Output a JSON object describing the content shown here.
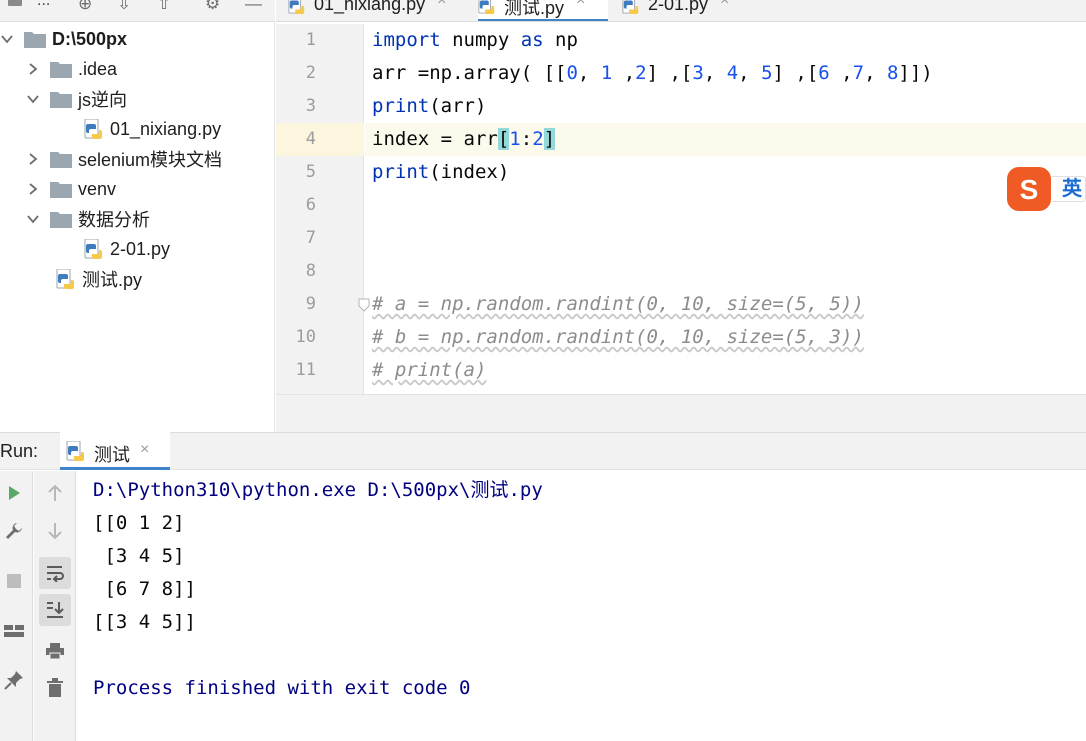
{
  "project_pane": {
    "toolbar_label": "..."
  },
  "tree": [
    {
      "label": "D:\\500px",
      "kind": "folder",
      "expanded": true,
      "bold": true
    },
    {
      "label": ".idea",
      "kind": "folder",
      "expanded": false
    },
    {
      "label": "js逆向",
      "kind": "folder",
      "expanded": true
    },
    {
      "label": "01_nixiang.py",
      "kind": "python-file"
    },
    {
      "label": "selenium模块文档",
      "kind": "folder",
      "expanded": false
    },
    {
      "label": "venv",
      "kind": "folder",
      "expanded": false
    },
    {
      "label": "数据分析",
      "kind": "folder",
      "expanded": true
    },
    {
      "label": "2-01.py",
      "kind": "python-file"
    },
    {
      "label": "测试.py",
      "kind": "python-file"
    }
  ],
  "editor_tabs": [
    {
      "label": "01_nixiang.py",
      "active": false
    },
    {
      "label": "测试.py",
      "active": true
    },
    {
      "label": "2-01.py",
      "active": false
    }
  ],
  "tab_close_glyph": "×",
  "code": {
    "line_numbers": [
      "1",
      "2",
      "3",
      "4",
      "5",
      "6",
      "7",
      "8",
      "9",
      "10",
      "11"
    ],
    "current_line": 4,
    "lines": [
      "import numpy as np",
      "arr =np.array( [[0, 1 ,2] ,[3, 4, 5] ,[6 ,7, 8]])",
      "print(arr)",
      "index = arr[1:2]",
      "print(index)",
      "",
      "",
      "",
      "# a = np.random.randint(0, 10, size=(5, 5))",
      "# b = np.random.randint(0, 10, size=(5, 3))",
      "# print(a)"
    ]
  },
  "ime_badge": {
    "logo_letter": "S",
    "language": "英"
  },
  "run_panel": {
    "label": "Run:",
    "tab_label": "测试",
    "console_lines": [
      {
        "text": "D:\\Python310\\python.exe D:\\500px\\测试.py",
        "kind": "system"
      },
      {
        "text": "[[0 1 2]",
        "kind": "output"
      },
      {
        "text": " [3 4 5]",
        "kind": "output"
      },
      {
        "text": " [6 7 8]]",
        "kind": "output"
      },
      {
        "text": "[[3 4 5]]",
        "kind": "output"
      },
      {
        "text": "",
        "kind": "output"
      },
      {
        "text": "Process finished with exit code 0",
        "kind": "system"
      }
    ]
  },
  "colors": {
    "keyword": "#0033b3",
    "number": "#1750eb",
    "comment": "#8c8c8c",
    "builtin": "#000080",
    "bracket_match": "#93d9d9",
    "run_green": "#59a869",
    "tab_underline": "#4083c9",
    "ime_orange": "#f05a24"
  }
}
